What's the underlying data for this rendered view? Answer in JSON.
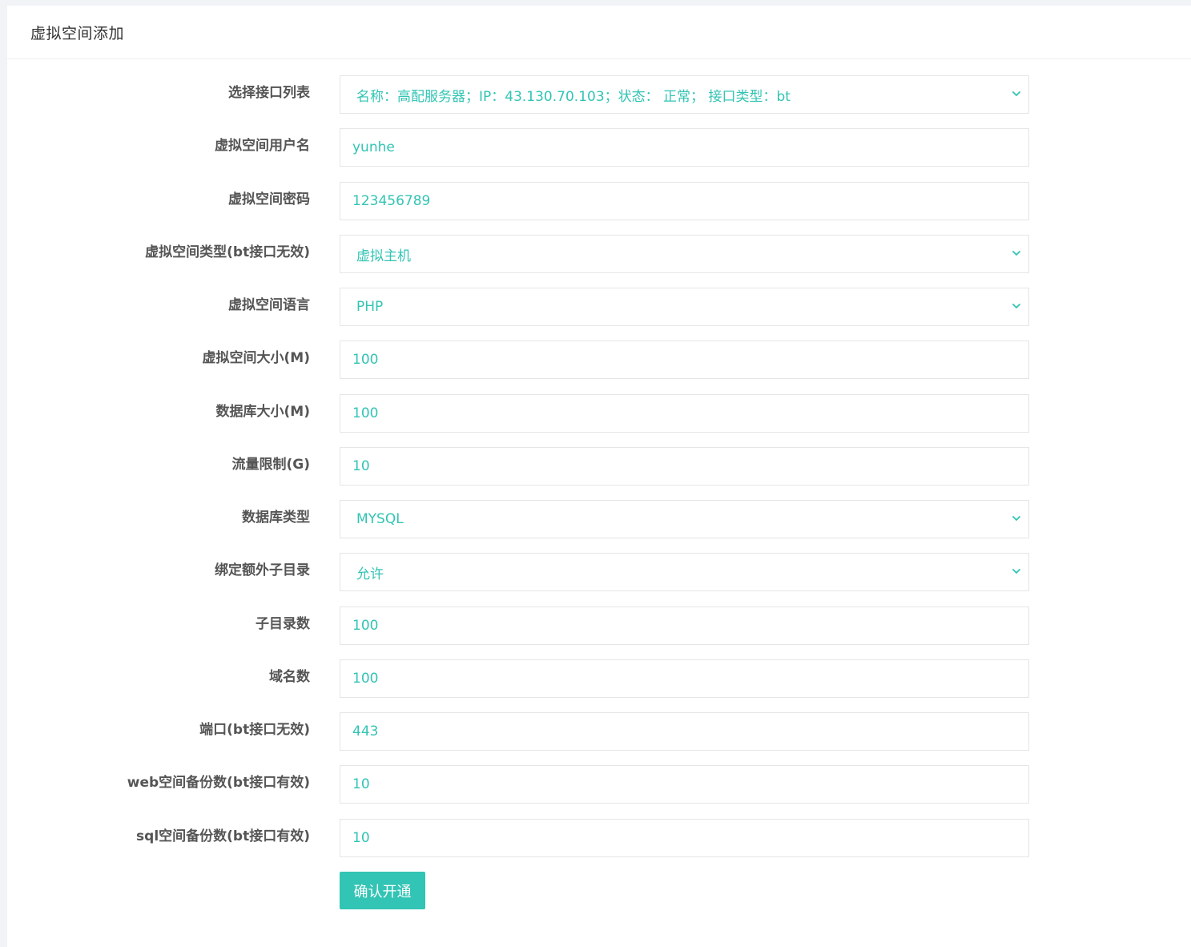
{
  "page": {
    "title": "虚拟空间添加"
  },
  "form": {
    "interface_list": {
      "label": "选择接口列表",
      "value": "名称：高配服务器；IP：43.130.70.103；状态： 正常； 接口类型：bt"
    },
    "username": {
      "label": "虚拟空间用户名",
      "value": "yunhe"
    },
    "password": {
      "label": "虚拟空间密码",
      "value": "123456789"
    },
    "space_type": {
      "label": "虚拟空间类型(bt接口无效)",
      "value": "虚拟主机"
    },
    "language": {
      "label": "虚拟空间语言",
      "value": "PHP"
    },
    "space_size": {
      "label": "虚拟空间大小(M)",
      "value": "100"
    },
    "db_size": {
      "label": "数据库大小(M)",
      "value": "100"
    },
    "traffic_limit": {
      "label": "流量限制(G)",
      "value": "10"
    },
    "db_type": {
      "label": "数据库类型",
      "value": "MYSQL"
    },
    "bind_subdir": {
      "label": "绑定额外子目录",
      "value": "允许"
    },
    "subdir_count": {
      "label": "子目录数",
      "value": "100"
    },
    "domain_count": {
      "label": "域名数",
      "value": "100"
    },
    "port": {
      "label": "端口(bt接口无效)",
      "value": "443"
    },
    "web_backup": {
      "label": "web空间备份数(bt接口有效)",
      "value": "10"
    },
    "sql_backup": {
      "label": "sql空间备份数(bt接口有效)",
      "value": "10"
    },
    "submit_label": "确认开通"
  },
  "colors": {
    "accent": "#32c4b4",
    "label": "#555555",
    "border": "#e6e6e6"
  }
}
